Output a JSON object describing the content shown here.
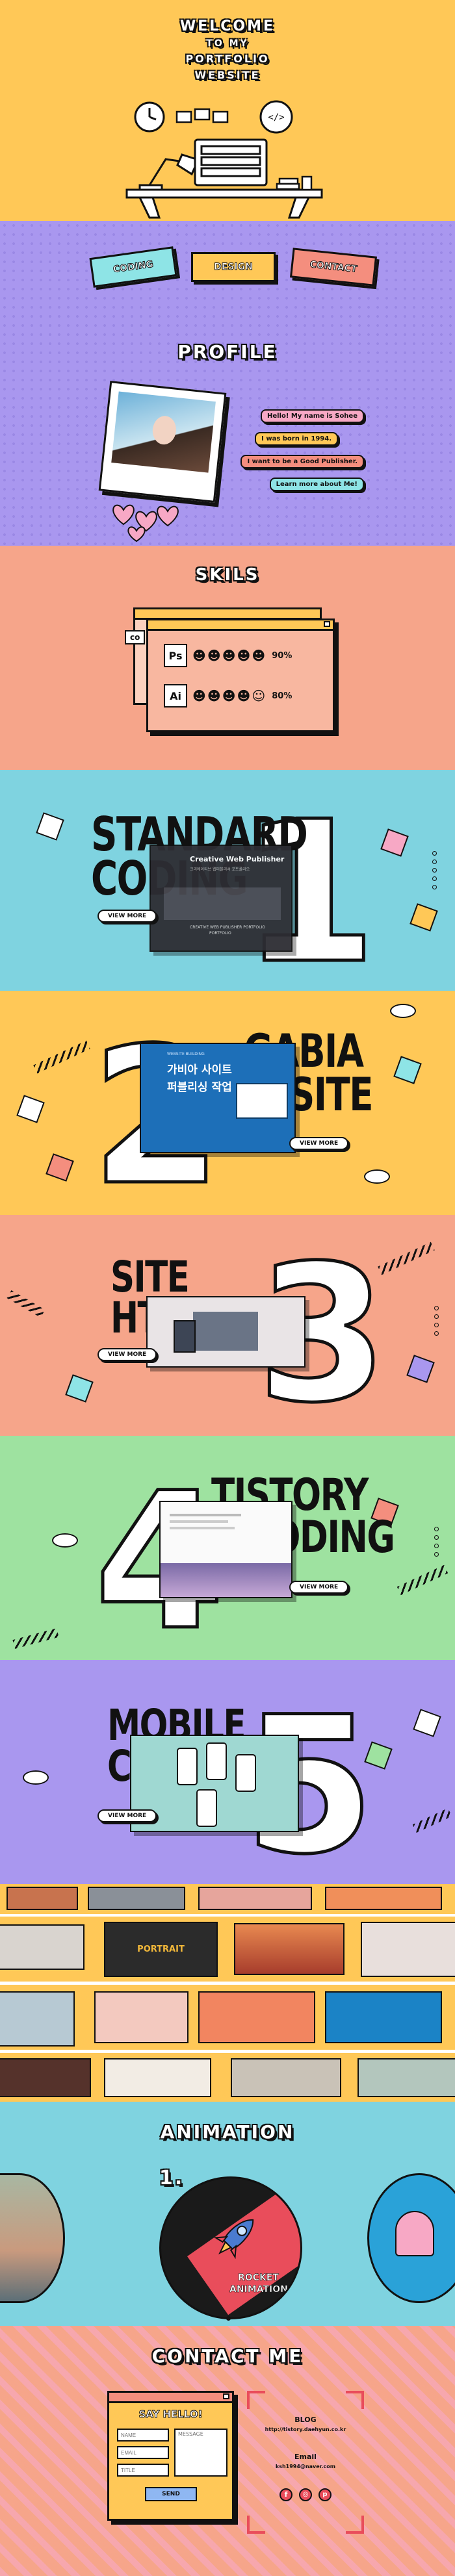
{
  "hero": {
    "line1": "WELCOME",
    "line2": "TO MY",
    "line3": "PORTFOLIO",
    "line4": "WEBSITE",
    "code_icon": "</>",
    "bg": "#ffc857"
  },
  "nav": {
    "coding": "CODING",
    "design": "DESIGN",
    "contact": "CONTACT"
  },
  "profile": {
    "title": "PROFILE",
    "bubbles": [
      "Hello! My name is Sohee",
      "I was born in 1994.",
      "I want to be a Good Publisher.",
      "Learn more about Me!"
    ]
  },
  "skills": {
    "title": "SKILS",
    "tab": "co",
    "items": [
      {
        "icon": "Ps",
        "percent": "90%"
      },
      {
        "icon": "Ai",
        "percent": "80%"
      }
    ]
  },
  "projects": [
    {
      "num": "1",
      "line1": "STANDARD",
      "line2": "CODING",
      "view": "VIEW MORE",
      "shot_title": "Creative Web Publisher",
      "shot_sub": "크리에이티브 웹퍼블리셔 포트폴리오",
      "shot_foot": "CREATIVE WEB PUBLISHER PORTFOLIO",
      "shot_foot2": "PORTFOLIO"
    },
    {
      "num": "2",
      "line1": "GABIA",
      "line2": "SITE",
      "view": "VIEW MORE",
      "shot_small": "WEBSITE BUILDING",
      "shot_title": "가비아 사이트",
      "shot_sub": "퍼블리싱 작업"
    },
    {
      "num": "3",
      "line1": "SITE",
      "line2": "HTML5",
      "view": "VIEW MORE"
    },
    {
      "num": "4",
      "line1": "TISTORY",
      "line2": "CODING",
      "view": "VIEW MORE"
    },
    {
      "num": "5",
      "line1": "MOBILE",
      "line2": "CODING",
      "view": "VIEW MORE"
    }
  ],
  "gallery": {
    "portrait_label": "PORTRAIT"
  },
  "animation": {
    "title": "ANIMATION",
    "num": "1.",
    "label1": "ROCKET",
    "label2": "ANIMATION"
  },
  "contact": {
    "title": "CONTACT ME",
    "form_title": "SAY HELLO!",
    "name_ph": "NAME",
    "email_ph": "EMAIL",
    "title_ph": "TITLE",
    "message_ph": "MESSAGE",
    "send": "SEND",
    "blog_label": "BLOG",
    "blog_url": "http://tistory.daehyun.co.kr",
    "email_label": "Email",
    "email_value": "ksh1994@naver.com"
  }
}
